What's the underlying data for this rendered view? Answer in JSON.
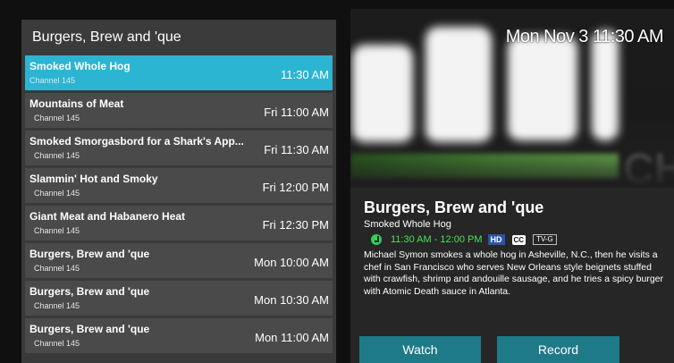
{
  "clock": "Mon Nov 3 11:30 AM",
  "panel": {
    "title": "Burgers, Brew and 'que"
  },
  "episodes": [
    {
      "title": "Smoked Whole Hog",
      "channel": "Channel 145",
      "time": "11:30 AM",
      "selected": true
    },
    {
      "title": "Mountains of Meat",
      "channel": "Channel 145",
      "time": "Fri 11:00 AM"
    },
    {
      "title": "Smoked Smorgasbord for a Shark's App...",
      "channel": "Channel 145",
      "time": "Fri 11:30 AM"
    },
    {
      "title": "Slammin' Hot and Smoky",
      "channel": "Channel 145",
      "time": "Fri 12:00 PM"
    },
    {
      "title": "Giant Meat and Habanero Heat",
      "channel": "Channel 145",
      "time": "Fri 12:30 PM"
    },
    {
      "title": "Burgers, Brew and 'que",
      "channel": "Channel 145",
      "time": "Mon 10:00 AM"
    },
    {
      "title": "Burgers, Brew and 'que",
      "channel": "Channel 145",
      "time": "Mon 10:30 AM"
    },
    {
      "title": "Burgers, Brew and 'que",
      "channel": "Channel 145",
      "time": "Mon 11:00 AM"
    }
  ],
  "details": {
    "show_title": "Burgers, Brew and 'que",
    "episode_title": "Smoked Whole Hog",
    "airtime": "11:30 AM - 12:00 PM",
    "badge_hd": "HD",
    "badge_cc": "CC",
    "rating": "TV-G",
    "description": "Michael Symon smokes a whole hog in Asheville, N.C., then he visits a chef in San Francisco who serves New Orleans style beignets stuffed with crawfish, shrimp and andouille sausage, and he tries a spicy burger with Atomic Death sauce in Atlanta.",
    "reminder_icon": "reminder-icon"
  },
  "buttons": {
    "watch": "Watch",
    "record": "Record"
  },
  "colors": {
    "selected_row": "#2bb5d2",
    "button": "#1f7a88",
    "airtime": "#4be05d",
    "hd_badge": "#2a55a8"
  }
}
